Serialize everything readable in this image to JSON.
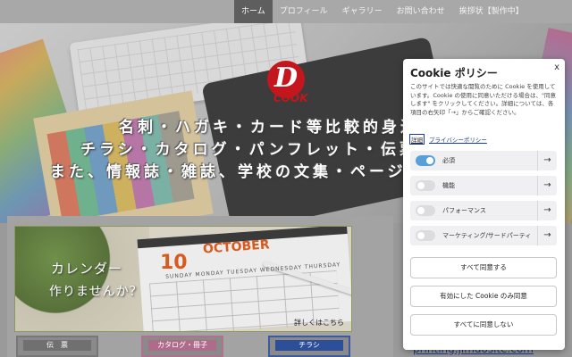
{
  "nav": {
    "items": [
      "ホーム",
      "プロフィール",
      "ギャラリー",
      "お問い合わせ",
      "挨拶状【製作中】"
    ],
    "active_index": 0
  },
  "hero": {
    "logo_letter": "D",
    "logo_word": "COOK",
    "lines": [
      "名刺・ハガキ・カード等比較的身近な印",
      "チラシ・カタログ・パンフレット・伝票など",
      "また、情報誌・雑誌、学校の文集・ページ物など広く"
    ]
  },
  "banner": {
    "number": "10",
    "month": "OCTOBER",
    "weekdays": "SUNDAY  MONDAY  TUESDAY  WEDNESDAY  THURSDAY",
    "title": "カレンダー",
    "subtitle": "作りませんか？",
    "more_link": "詳しくはこちら"
  },
  "categories": [
    "伝　票",
    "カタログ・冊子",
    "チラシ"
  ],
  "site_link": "printing.jimdosite.com",
  "cookie": {
    "title": "Cookie ポリシー",
    "close": "x",
    "text": "このサイトでは快適な閲覧のために Cookie を使用しています。Cookie の使用に同意いただける場合は、\"同意します\" をクリックしてください。詳細については、各項目の右矢印「→」からご確認ください。",
    "details_link": "詳細",
    "privacy_link": "プライバシーポリシー",
    "categories": [
      {
        "label": "必須",
        "enabled": true
      },
      {
        "label": "機能",
        "enabled": false
      },
      {
        "label": "パフォーマンス",
        "enabled": false
      },
      {
        "label": "マーケティング/サードパーティ",
        "enabled": false
      }
    ],
    "arrow": "→",
    "buttons": {
      "accept_all": "すべて同意する",
      "accept_enabled": "有効にした Cookie のみ同意",
      "reject_all": "すべてに同意しない"
    }
  },
  "colors": {
    "brand_red": "#c4161c",
    "toggle_on": "#5aa0d8",
    "link_blue": "#1c3d8a"
  }
}
